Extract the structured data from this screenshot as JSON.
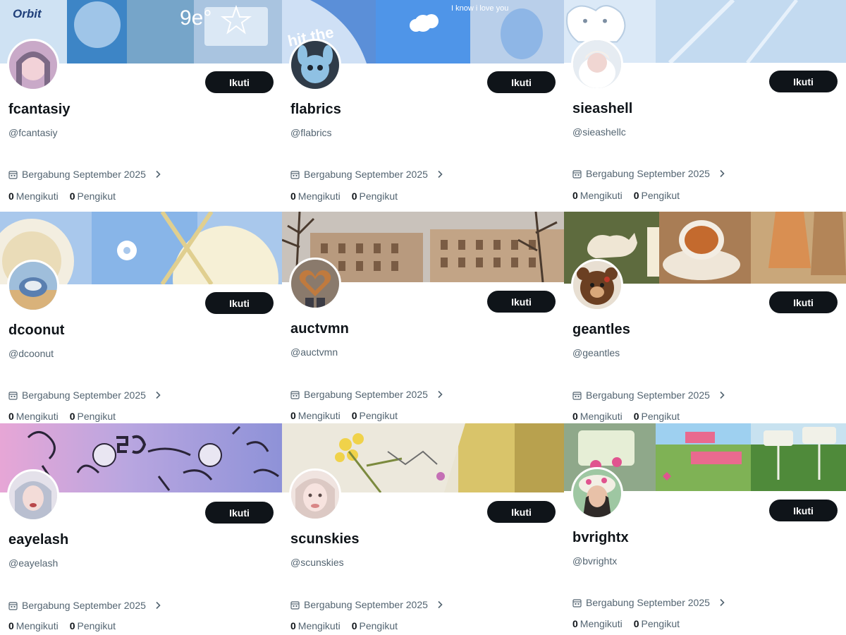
{
  "follow_label": "Ikuti",
  "joined_label": "Bergabung September 2025",
  "following_label": "Mengikuti",
  "followers_label": "Pengikut",
  "banner_text": {
    "fcantasiy": [
      "Orbit",
      "9e°"
    ],
    "flabrics": [
      "hit the",
      "I know i love you"
    ]
  },
  "profiles": [
    {
      "name": "fcantasiy",
      "handle": "@fcantasiy",
      "following": "0",
      "followers": "0"
    },
    {
      "name": "flabrics",
      "handle": "@flabrics",
      "following": "0",
      "followers": "0"
    },
    {
      "name": "sieashell",
      "handle": "@sieashellc",
      "following": "0",
      "followers": "0"
    },
    {
      "name": "dcoonut",
      "handle": "@dcoonut",
      "following": "0",
      "followers": "0"
    },
    {
      "name": "auctvmn",
      "handle": "@auctvmn",
      "following": "0",
      "followers": "0"
    },
    {
      "name": "geantles",
      "handle": "@geantles",
      "following": "0",
      "followers": "0"
    },
    {
      "name": "eayelash",
      "handle": "@eayelash",
      "following": "0",
      "followers": "0"
    },
    {
      "name": "scunskies",
      "handle": "@scunskies",
      "following": "0",
      "followers": "0"
    },
    {
      "name": "bvrightx",
      "handle": "@bvrightx",
      "following": "0",
      "followers": "0"
    }
  ]
}
